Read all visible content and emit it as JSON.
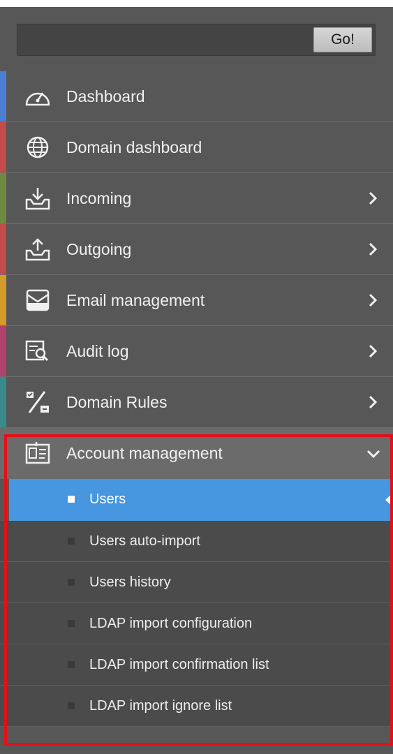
{
  "search": {
    "placeholder": "",
    "value": "",
    "go_label": "Go!"
  },
  "menu": [
    {
      "label": "Dashboard",
      "icon": "gauge-icon",
      "accent": "#4a7fd4",
      "has_arrow": false
    },
    {
      "label": "Domain dashboard",
      "icon": "globe-icon",
      "accent": "#c24b4b",
      "has_arrow": false
    },
    {
      "label": "Incoming",
      "icon": "inbox-download-icon",
      "accent": "#6e8a3e",
      "has_arrow": true
    },
    {
      "label": "Outgoing",
      "icon": "outbox-upload-icon",
      "accent": "#c24b4b",
      "has_arrow": true
    },
    {
      "label": "Email management",
      "icon": "envelope-icon",
      "accent": "#d49a2a",
      "has_arrow": true
    },
    {
      "label": "Audit log",
      "icon": "audit-search-icon",
      "accent": "#b0436e",
      "has_arrow": true
    },
    {
      "label": "Domain Rules",
      "icon": "percent-rules-icon",
      "accent": "#3a8a8a",
      "has_arrow": true
    }
  ],
  "account_management": {
    "label": "Account management",
    "icon": "id-card-icon",
    "items": [
      {
        "label": "Users",
        "active": true
      },
      {
        "label": "Users auto-import",
        "active": false
      },
      {
        "label": "Users history",
        "active": false
      },
      {
        "label": "LDAP import configuration",
        "active": false
      },
      {
        "label": "LDAP import confirmation list",
        "active": false
      },
      {
        "label": "LDAP import ignore list",
        "active": false
      }
    ]
  },
  "colors": {
    "highlight_box": "#e3101a",
    "active_item": "#4697e0",
    "panel": "#575757"
  }
}
